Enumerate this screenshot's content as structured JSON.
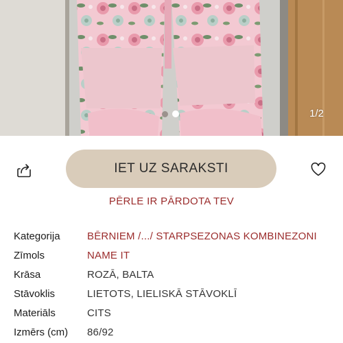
{
  "gallery": {
    "counter": "1/2",
    "dots": [
      {
        "active": false
      },
      {
        "active": true
      }
    ]
  },
  "actions": {
    "share_icon": "share-icon",
    "primary_label": "IET UZ SARAKSTI",
    "favorite_icon": "heart-icon"
  },
  "status": {
    "sold_text": "PĒRLE IR PĀRDOTA TEV"
  },
  "details": {
    "rows": [
      {
        "label": "Kategorija",
        "value": "BĒRNIEM /.../ STARPSEZONAS KOMBINEZONI"
      },
      {
        "label": "Zīmols",
        "value": "NAME IT"
      },
      {
        "label": "Krāsa",
        "value": "ROZĀ, BALTA"
      },
      {
        "label": "Stāvoklis",
        "value": "LIETOTS, LIELISKĀ STĀVOKLĪ"
      },
      {
        "label": "Materiāls",
        "value": "CITS"
      },
      {
        "label": "Izmērs (cm)",
        "value": "86/92"
      }
    ]
  },
  "colors": {
    "accent": "#9b2c2c",
    "button_bg": "#d9ccba"
  }
}
